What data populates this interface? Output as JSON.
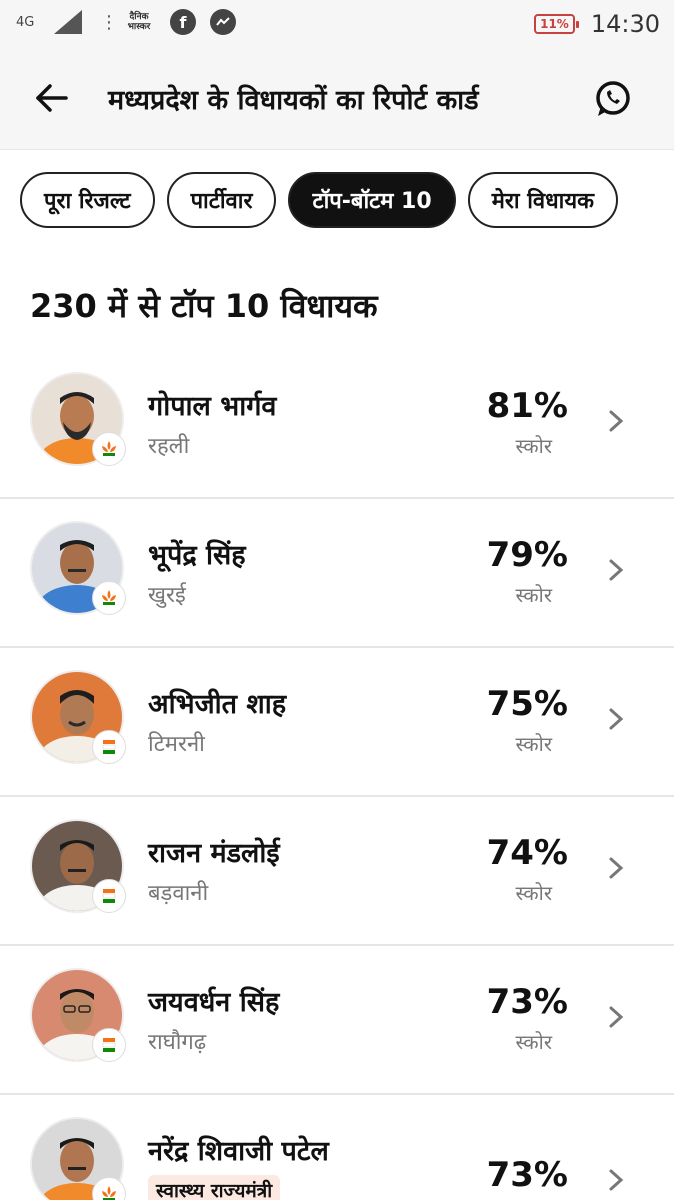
{
  "status_bar": {
    "network": "4G",
    "brand": "दैनिक भास्कर",
    "battery": "11%",
    "time": "14:30",
    "icons": [
      "signal-icon",
      "facebook-icon",
      "messenger-icon",
      "battery-icon"
    ]
  },
  "header": {
    "title": "मध्यप्रदेश के विधायकों का रिपोर्ट कार्ड",
    "back_icon": "arrow-left-icon",
    "share_icon": "whatsapp-icon"
  },
  "tabs": [
    {
      "label": "पूरा रिजल्ट",
      "active": false
    },
    {
      "label": "पार्टीवार",
      "active": false
    },
    {
      "label": "टॉप-बॉटम 10",
      "active": true
    },
    {
      "label": "मेरा विधायक",
      "active": false
    }
  ],
  "section_title": "230 में से टॉप 10 विधायक",
  "score_label": "स्कोर",
  "party_colors": {
    "bjp": "#f47216",
    "inc": "#138808"
  },
  "mlas": [
    {
      "name": "गोपाल भार्गव",
      "constituency": "रहली",
      "score": "81%",
      "party": "bjp"
    },
    {
      "name": "भूपेंद्र सिंह",
      "constituency": "खुरई",
      "score": "79%",
      "party": "bjp"
    },
    {
      "name": "अभिजीत शाह",
      "constituency": "टिमरनी",
      "score": "75%",
      "party": "inc"
    },
    {
      "name": "राजन मंडलोई",
      "constituency": "बड़वानी",
      "score": "74%",
      "party": "inc"
    },
    {
      "name": "जयवर्धन सिंह",
      "constituency": "राघौगढ़",
      "score": "73%",
      "party": "inc"
    },
    {
      "name": "नरेंद्र शिवाजी पटेल",
      "role": "स्वास्थ्य राज्यमंत्री",
      "score": "73%",
      "party": "bjp"
    }
  ]
}
